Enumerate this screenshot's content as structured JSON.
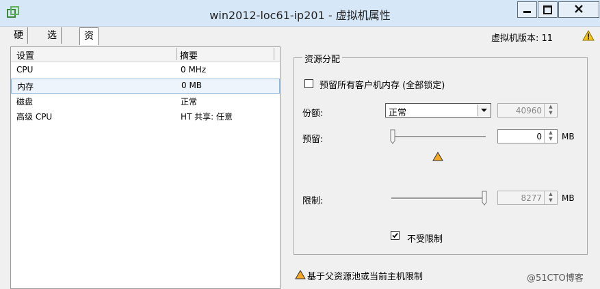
{
  "window": {
    "title": "win2012-loc61-ip201 - 虚拟机属性",
    "minimize_icon": "minimize-icon",
    "maximize_icon": "maximize-icon",
    "close_icon": "close-icon",
    "app_icon": "vmware-icon"
  },
  "tabs": [
    {
      "label": "硬件",
      "active": false
    },
    {
      "label": "选项",
      "active": false
    },
    {
      "label": "资源",
      "active": true
    }
  ],
  "header": {
    "version_label": "虚拟机版本: 11",
    "warning_icon": "warning-icon"
  },
  "settings_table": {
    "columns": [
      "设置",
      "摘要"
    ],
    "rows": [
      {
        "setting": "CPU",
        "summary": "0 MHz",
        "selected": false
      },
      {
        "setting": "内存",
        "summary": "0 MB",
        "selected": true
      },
      {
        "setting": "磁盘",
        "summary": "正常",
        "selected": false
      },
      {
        "setting": "高级 CPU",
        "summary": "HT 共享: 任意",
        "selected": false
      }
    ]
  },
  "resource_allocation": {
    "title": "资源分配",
    "reserve_all_label": "预留所有客户机内存 (全部锁定)",
    "reserve_all_checked": false,
    "shares_label": "份额:",
    "shares_value": "正常",
    "shares_number": "40960",
    "reservation_label": "预留:",
    "reservation_value": "0",
    "reservation_unit": "MB",
    "reservation_slider_fraction": 0,
    "limit_label": "限制:",
    "limit_value": "8277",
    "limit_unit": "MB",
    "limit_slider_fraction": 1,
    "unlimited_label": "不受限制",
    "unlimited_checked": true
  },
  "footer": {
    "note": "基于父资源池或当前主机限制"
  },
  "watermark": "@51CTO博客",
  "colors": {
    "titlebar": "#d6e7f7",
    "warning": "#f5a623",
    "selection": "#eef4fb"
  }
}
